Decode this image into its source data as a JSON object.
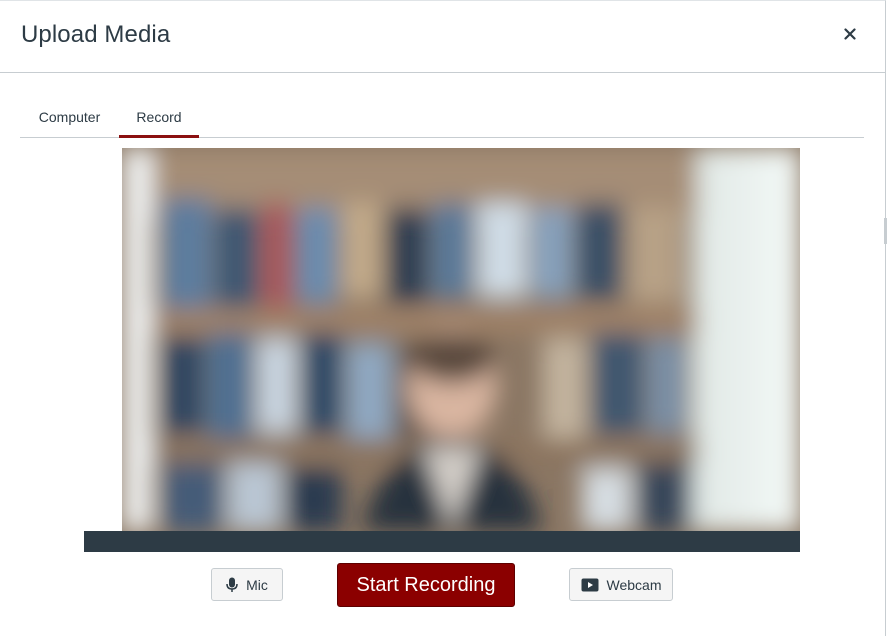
{
  "dialog": {
    "title": "Upload Media",
    "close_label": "×"
  },
  "tabs": [
    {
      "label": "Computer",
      "selected": false
    },
    {
      "label": "Record",
      "selected": true
    }
  ],
  "video": {
    "preview_icon": "webcam-preview",
    "accent_color": "#8b0000"
  },
  "controls": {
    "mic_label": "Mic",
    "start_label": "Start Recording",
    "webcam_label": "Webcam"
  }
}
